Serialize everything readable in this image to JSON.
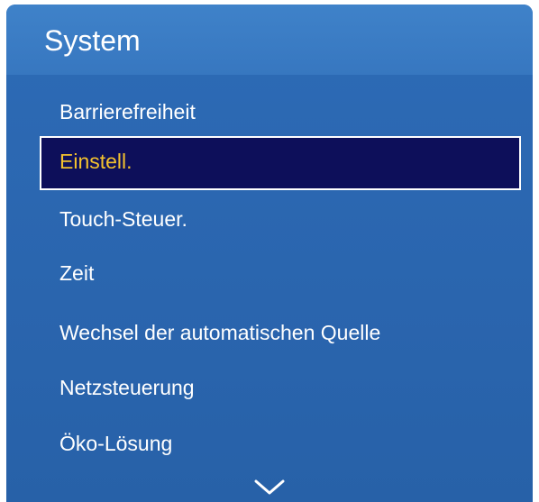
{
  "header": {
    "title": "System"
  },
  "menu": {
    "items": [
      {
        "label": "Barrierefreiheit",
        "selected": false
      },
      {
        "label": "Einstell.",
        "selected": true
      },
      {
        "label": "Touch-Steuer.",
        "selected": false
      },
      {
        "label": "Zeit",
        "selected": false
      },
      {
        "label": "Wechsel der automatischen Quelle",
        "selected": false
      },
      {
        "label": "Netzsteuerung",
        "selected": false
      },
      {
        "label": "Öko-Lösung",
        "selected": false
      }
    ]
  },
  "scroll": {
    "icon": "chevron-down-icon"
  },
  "colors": {
    "panel": "#2a65ae",
    "header": "#3b7cc4",
    "selected_background": "#0d0f5a",
    "selected_text": "#f4c22e",
    "text": "#ffffff"
  }
}
